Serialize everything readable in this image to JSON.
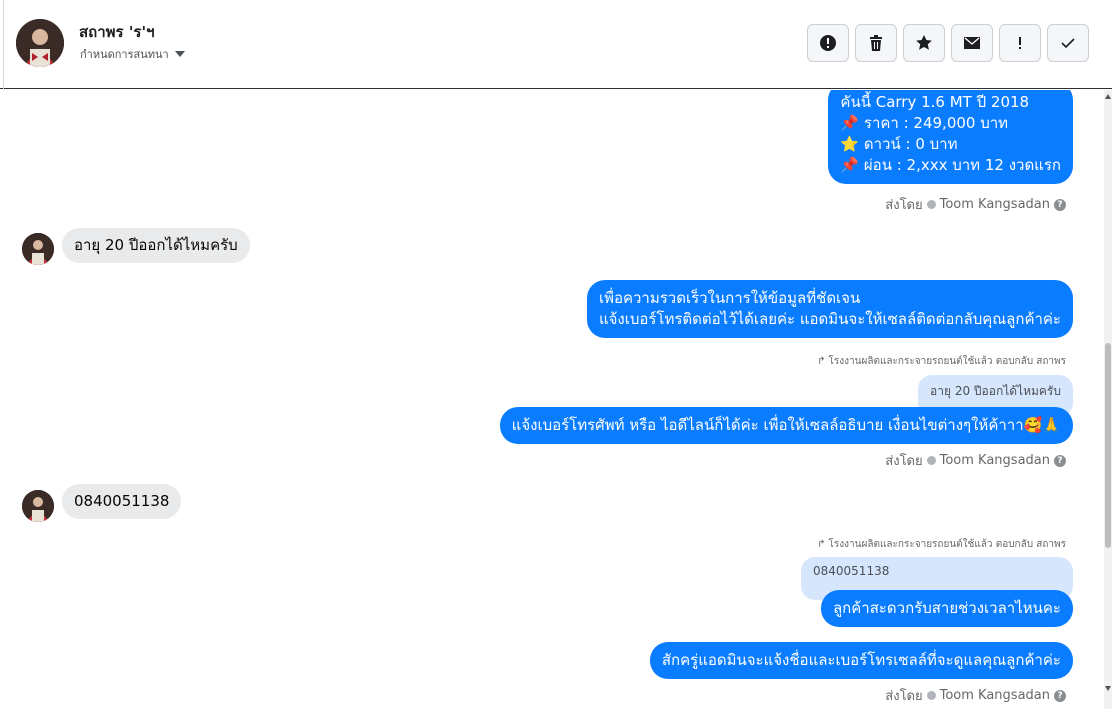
{
  "header": {
    "contact_name": "สถาพร 'ร'ฯ",
    "assign_label": "กำหนดการสนทนา",
    "toolbar": [
      {
        "name": "mark-spam-button",
        "icon": "alert-circle-icon"
      },
      {
        "name": "delete-button",
        "icon": "trash-icon"
      },
      {
        "name": "star-button",
        "icon": "star-icon"
      },
      {
        "name": "mark-unread-button",
        "icon": "envelope-icon"
      },
      {
        "name": "important-button",
        "icon": "exclamation-icon"
      },
      {
        "name": "done-button",
        "icon": "checkmark-icon"
      }
    ]
  },
  "messages": {
    "m1": {
      "line1": "คันนี้ Carry 1.6 MT  ปี 2018",
      "line2": "ราคา : 249,000 บาท",
      "line3": "ดาวน์ : 0 บาท",
      "line4": "ผ่อน : 2,xxx บาท 12 งวดแรก"
    },
    "m2": "อายุ 20 ปีออกได้ไหมครับ",
    "m3": {
      "line1": "เพื่อความรวดเร็วในการให้ข้อมูลที่ชัดเจน",
      "line2": "แจ้งเบอร์โทรติดต่อไว้ได้เลยค่ะ แอดมินจะให้เซลล์ติดต่อกลับคุณลูกค้าค่ะ"
    },
    "reply1_label": "โรงงานผลิตและกระจายรถยนต์ใช้แล้ว ตอบกลับ สถาพร",
    "reply1_quote": "อายุ 20 ปีออกได้ไหมครับ",
    "m4": "แจ้งเบอร์โทรศัพท์ หรือ ไอดีไลน์ก็ได้ค่ะ เพื่อให้เซลล์อธิบาย เงื่อนไขต่างๆให้ค้าาา",
    "m4_emoji": "🥰🙏",
    "m5": "0840051138",
    "reply2_label": "โรงงานผลิตและกระจายรถยนต์ใช้แล้ว ตอบกลับ สถาพร",
    "reply2_quote": "0840051138",
    "m6": "ลูกค้าสะดวกรับสายช่วงเวลาไหนคะ",
    "m7": "สักครู่แอดมินจะแจ้งชื่อและเบอร์โทรเซลล์ที่จะดูแลคุณลูกค้าค่ะ",
    "sent_by_prefix": "ส่งโดย",
    "sent_by_name": "Toom Kangsadan"
  },
  "colors": {
    "outgoing_bubble": "#0a7cff",
    "incoming_bubble": "#e9eaeb",
    "quote_bubble": "#d6e6fd"
  }
}
